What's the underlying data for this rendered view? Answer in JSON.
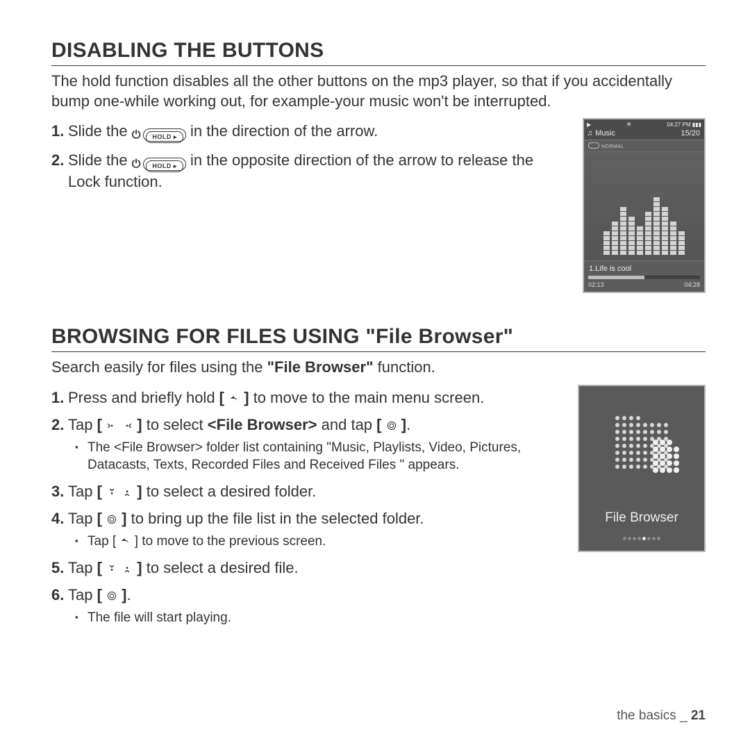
{
  "section1": {
    "heading": "DISABLING THE BUTTONS",
    "intro": "The hold function disables all the other buttons on the mp3 player, so that if you accidentally bump one-while working out, for example-your music won't be interrupted.",
    "step1a": "Slide the ",
    "step1b": " in the direction of the arrow.",
    "step2a": "Slide the ",
    "step2b": " in the opposite direction of the arrow to release the Lock function.",
    "hold_label": "HOLD ▸"
  },
  "music_player": {
    "time_status": "04:27 PM",
    "app": "Music",
    "counter": "15/20",
    "mode": "NORMAL",
    "track": "1.Life is cool",
    "elapsed": "02:13",
    "total": "04:28"
  },
  "section2": {
    "heading": "BROWSING FOR FILES USING \"File Browser\"",
    "intro_a": "Search easily for files using the ",
    "intro_b": "\"File Browser\"",
    "intro_c": " function.",
    "s1": "Press and briefly hold ",
    "s1b": " to move to the main menu screen.",
    "s2a": "Tap ",
    "s2b": " to select ",
    "s2c": "<File Browser>",
    "s2d": " and tap ",
    "s2e": ".",
    "s2_sub": "The <File Browser> folder list containing \"Music, Playlists, Video, Pictures, Datacasts, Texts, Recorded Files and Received Files \" appears.",
    "s3a": "Tap ",
    "s3b": " to select a desired folder.",
    "s4a": "Tap ",
    "s4b": " to bring up the file list in the selected folder.",
    "s4_sub_a": "Tap [ ",
    "s4_sub_b": " ] to move to the previous screen.",
    "s5a": "Tap ",
    "s5b": " to select a desired file.",
    "s6a": "Tap ",
    "s6b": ".",
    "s6_sub": "The file will start playing."
  },
  "file_browser": {
    "label": "File Browser"
  },
  "footer": {
    "section": "the basics",
    "sep": " _ ",
    "page": "21"
  }
}
